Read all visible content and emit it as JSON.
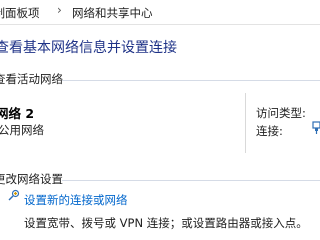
{
  "breadcrumb": {
    "items": [
      "控制面板项",
      "网络和共享中心"
    ],
    "separator": "›"
  },
  "page": {
    "title": "查看基本网络信息并设置连接"
  },
  "active_networks": {
    "heading": "查看活动网络",
    "network": {
      "name": "网络 2",
      "type": "公用网络"
    },
    "access_type_label": "访问类型:",
    "connections_label": "连接:"
  },
  "change_settings": {
    "heading": "更改网络设置",
    "new_connection_link": "设置新的连接或网络",
    "new_connection_desc": "设置宽带、拨号或 VPN 连接；或设置路由器或接入点。"
  },
  "colors": {
    "title": "#1e3287",
    "link": "#0066cc"
  }
}
